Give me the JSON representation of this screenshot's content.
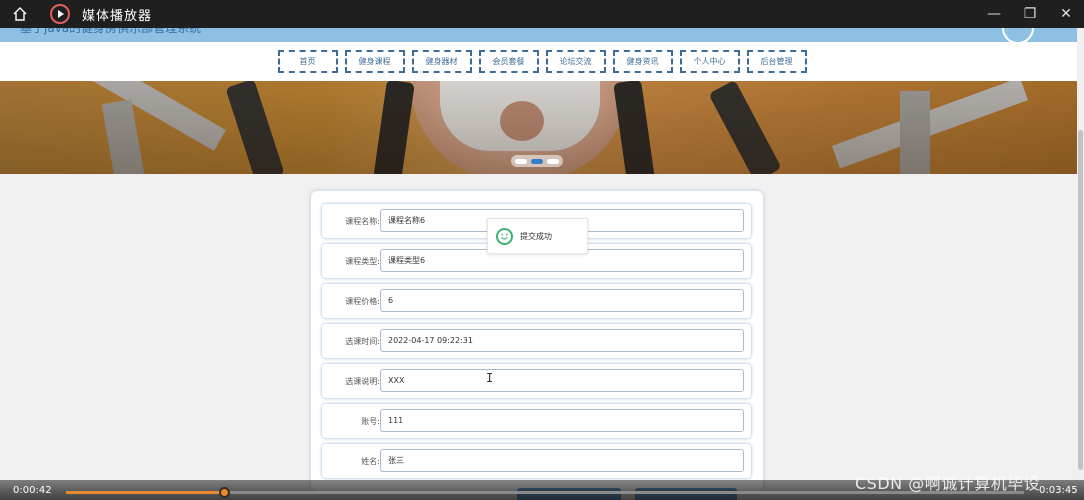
{
  "window": {
    "title": "媒体播放器",
    "icons": [
      "home-icon",
      "play-icon",
      "minimize-icon",
      "restore-icon",
      "close-icon"
    ]
  },
  "site": {
    "title": "基于java的健身房俱乐部管理系统",
    "nav": [
      "首页",
      "健身课程",
      "健身器材",
      "会员套餐",
      "论坛交流",
      "健身资讯",
      "个人中心",
      "后台管理"
    ]
  },
  "form": {
    "rows": [
      {
        "label": "课程名称:",
        "value": "课程名称6"
      },
      {
        "label": "课程类型:",
        "value": "课程类型6"
      },
      {
        "label": "课程价格:",
        "value": "6"
      },
      {
        "label": "选课时间:",
        "value": "2022-04-17 09:22:31"
      },
      {
        "label": "选课说明:",
        "value": "XXX"
      },
      {
        "label": "账号:",
        "value": "111"
      },
      {
        "label": "姓名:",
        "value": "张三"
      }
    ]
  },
  "toast": {
    "text": "提交成功",
    "icon": "smile-icon"
  },
  "player": {
    "current_time": "0:00:42",
    "total_time": "0:03:45",
    "progress": 0.166
  },
  "watermark": "CSDN @啊诚计算机毕设",
  "colors": {
    "accent": "#e68a2e",
    "nav_border": "#3e6c99",
    "header_bg": "#8dc0e3",
    "toast_icon": "#3cb371"
  }
}
